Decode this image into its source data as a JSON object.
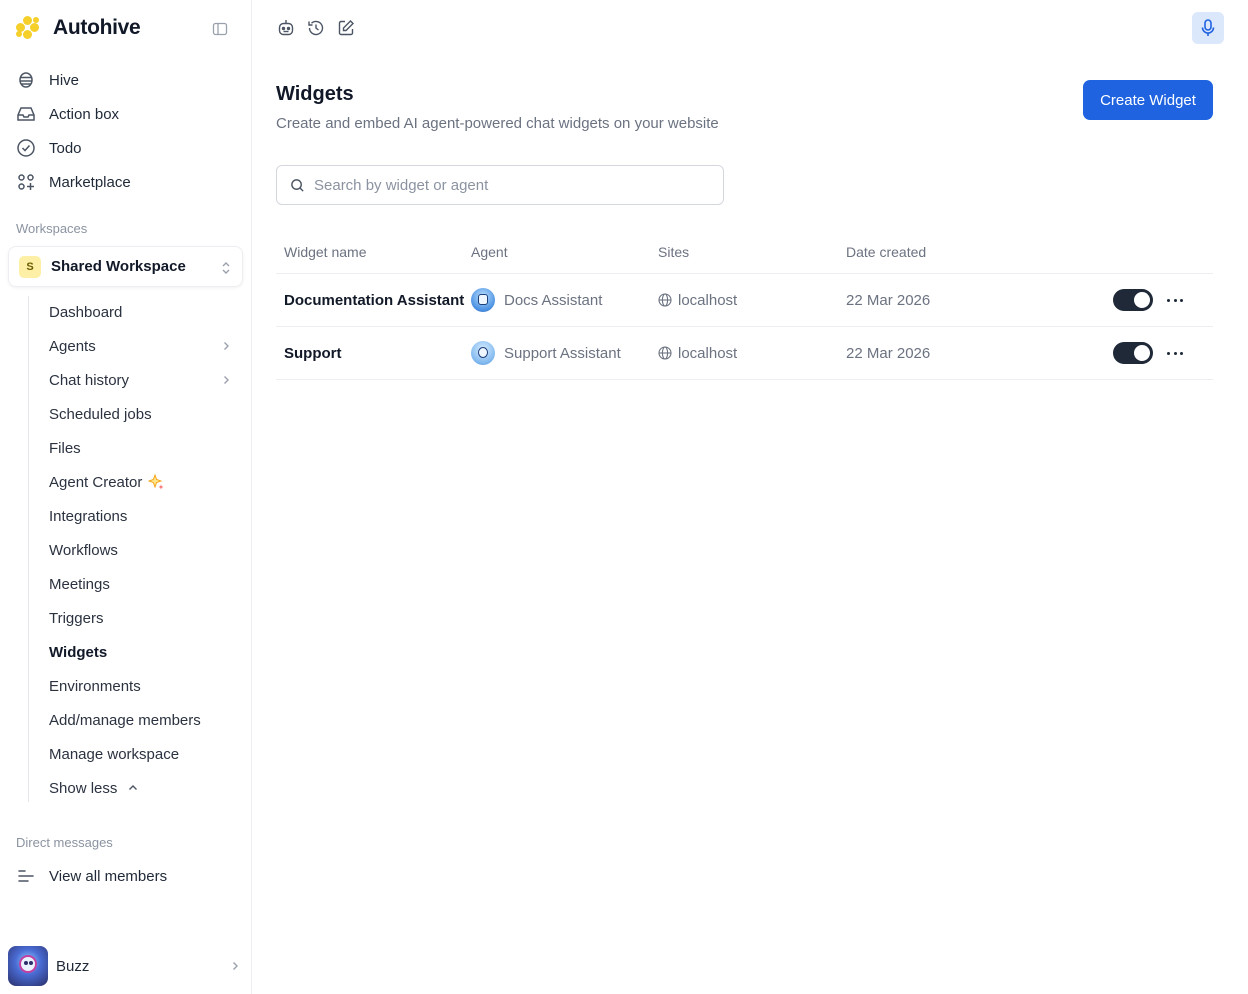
{
  "app": {
    "name": "Autohive"
  },
  "nav": [
    {
      "label": "Hive",
      "icon": "hive-icon"
    },
    {
      "label": "Action box",
      "icon": "inbox-icon"
    },
    {
      "label": "Todo",
      "icon": "check-circle-icon"
    },
    {
      "label": "Marketplace",
      "icon": "apps-icon"
    }
  ],
  "workspaces": {
    "section_label": "Workspaces",
    "current": {
      "initial": "S",
      "name": "Shared Workspace"
    },
    "items": [
      {
        "label": "Dashboard"
      },
      {
        "label": "Agents",
        "has_chevron": true
      },
      {
        "label": "Chat history",
        "has_chevron": true
      },
      {
        "label": "Scheduled jobs"
      },
      {
        "label": "Files"
      },
      {
        "label": "Agent Creator",
        "sparkle": true
      },
      {
        "label": "Integrations"
      },
      {
        "label": "Workflows"
      },
      {
        "label": "Meetings"
      },
      {
        "label": "Triggers"
      },
      {
        "label": "Widgets",
        "active": true
      },
      {
        "label": "Environments"
      },
      {
        "label": "Add/manage members"
      },
      {
        "label": "Manage workspace"
      },
      {
        "label": "Show less"
      }
    ]
  },
  "direct_messages": {
    "section_label": "Direct messages",
    "view_all": "View all members"
  },
  "user": {
    "name": "Buzz"
  },
  "page": {
    "title": "Widgets",
    "subtitle": "Create and embed AI agent-powered chat widgets on your website",
    "create_button": "Create Widget",
    "search_placeholder": "Search by widget or agent"
  },
  "table": {
    "columns": [
      "Widget name",
      "Agent",
      "Sites",
      "Date created"
    ],
    "rows": [
      {
        "name": "Documentation Assistant",
        "agent": "Docs Assistant",
        "site": "localhost",
        "date": "22 Mar 2026",
        "enabled": true
      },
      {
        "name": "Support",
        "agent": "Support Assistant",
        "site": "localhost",
        "date": "22 Mar 2026",
        "enabled": true
      }
    ]
  },
  "colors": {
    "accent": "#1f63e0",
    "brand": "#f5cf2a",
    "toggle_on": "#1f2937"
  }
}
